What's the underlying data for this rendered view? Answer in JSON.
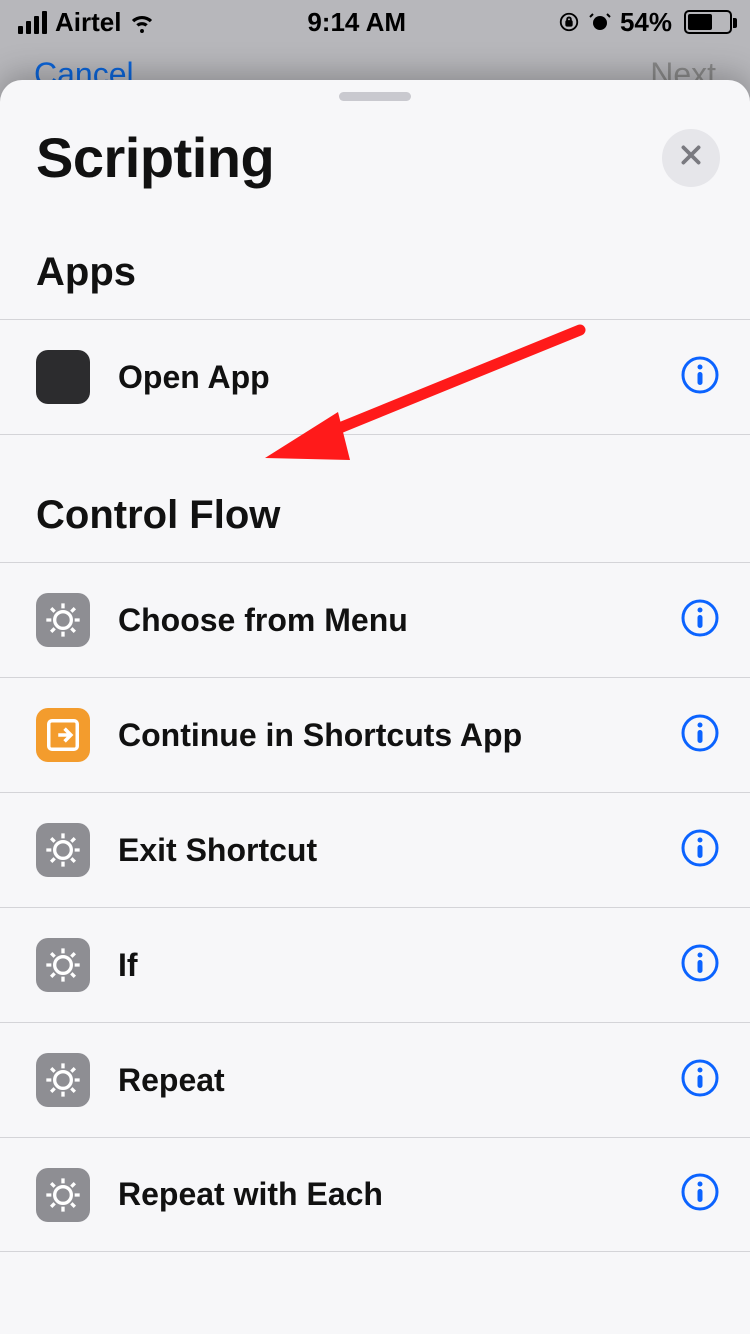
{
  "statusbar": {
    "carrier": "Airtel",
    "time": "9:14 AM",
    "battery_pct": "54%",
    "battery_level_pct": 54
  },
  "background_nav": {
    "cancel": "Cancel",
    "next": "Next"
  },
  "sheet": {
    "title": "Scripting"
  },
  "sections": [
    {
      "label": "Apps",
      "items": [
        {
          "id": "open-app",
          "label": "Open App",
          "icon": "apps-grid-icon"
        }
      ]
    },
    {
      "label": "Control Flow",
      "items": [
        {
          "id": "choose-from-menu",
          "label": "Choose from Menu",
          "icon": "gear-icon"
        },
        {
          "id": "continue-in-shortcuts",
          "label": "Continue in Shortcuts App",
          "icon": "continue-icon"
        },
        {
          "id": "exit-shortcut",
          "label": "Exit Shortcut",
          "icon": "gear-icon"
        },
        {
          "id": "if",
          "label": "If",
          "icon": "gear-icon"
        },
        {
          "id": "repeat",
          "label": "Repeat",
          "icon": "gear-icon"
        },
        {
          "id": "repeat-with-each",
          "label": "Repeat with Each",
          "icon": "gear-icon"
        }
      ]
    }
  ],
  "annotation": {
    "type": "red-arrow",
    "points_to": "open-app"
  }
}
